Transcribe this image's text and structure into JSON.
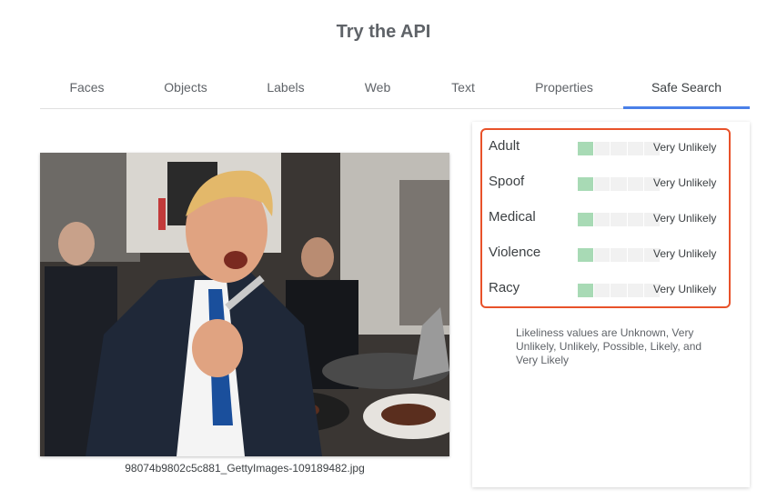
{
  "page": {
    "title": "Try the API"
  },
  "tabs": [
    {
      "label": "Faces",
      "active": false
    },
    {
      "label": "Objects",
      "active": false
    },
    {
      "label": "Labels",
      "active": false
    },
    {
      "label": "Web",
      "active": false
    },
    {
      "label": "Text",
      "active": false
    },
    {
      "label": "Properties",
      "active": false
    },
    {
      "label": "Safe Search",
      "active": true
    }
  ],
  "image": {
    "filename": "98074b9802c5c881_GettyImages-109189482.jpg"
  },
  "safe_search": {
    "rows": [
      {
        "label": "Adult",
        "value": "Very Unlikely",
        "level": 1,
        "max": 5
      },
      {
        "label": "Spoof",
        "value": "Very Unlikely",
        "level": 1,
        "max": 5
      },
      {
        "label": "Medical",
        "value": "Very Unlikely",
        "level": 1,
        "max": 5
      },
      {
        "label": "Violence",
        "value": "Very Unlikely",
        "level": 1,
        "max": 5
      },
      {
        "label": "Racy",
        "value": "Very Unlikely",
        "level": 1,
        "max": 5
      }
    ],
    "note": "Likeliness values are Unknown, Very Unlikely, Unlikely, Possible, Likely, and Very Likely"
  },
  "colors": {
    "accent": "#4a80e8",
    "highlight_border": "#e8522a",
    "meter_on": "#a8dab5",
    "meter_off": "#f1f1f1"
  }
}
